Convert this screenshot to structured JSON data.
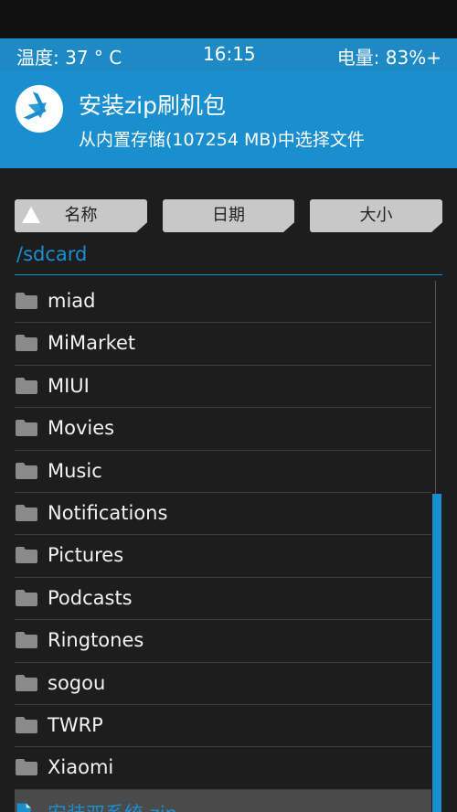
{
  "status": {
    "temperature": "温度: 37 ° C",
    "time": "16:15",
    "battery": "电量: 83%+"
  },
  "header": {
    "title": "安装zip刷机包",
    "subtitle": "从内置存储(107254 MB)中选择文件"
  },
  "sort": {
    "name": "名称",
    "date": "日期",
    "size": "大小"
  },
  "path": "/sdcard",
  "files": [
    {
      "name": "miad",
      "type": "folder"
    },
    {
      "name": "MiMarket",
      "type": "folder"
    },
    {
      "name": "MIUI",
      "type": "folder"
    },
    {
      "name": "Movies",
      "type": "folder"
    },
    {
      "name": "Music",
      "type": "folder"
    },
    {
      "name": "Notifications",
      "type": "folder"
    },
    {
      "name": "Pictures",
      "type": "folder"
    },
    {
      "name": "Podcasts",
      "type": "folder"
    },
    {
      "name": "Ringtones",
      "type": "folder"
    },
    {
      "name": "sogou",
      "type": "folder"
    },
    {
      "name": "TWRP",
      "type": "folder"
    },
    {
      "name": "Xiaomi",
      "type": "folder"
    },
    {
      "name": "安装双系统.zip",
      "type": "file",
      "selected": true
    }
  ],
  "colors": {
    "accent": "#1a8fd0",
    "background": "#1d1d1d"
  }
}
